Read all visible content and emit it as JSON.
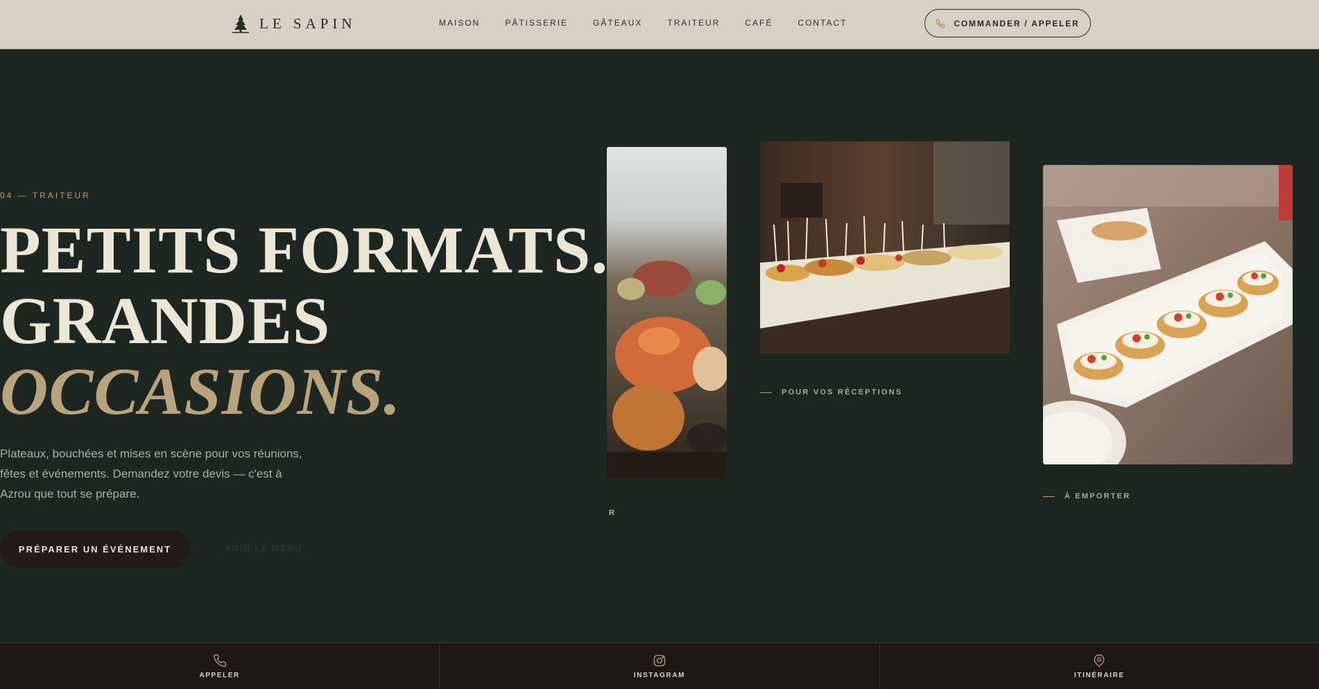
{
  "header": {
    "logo_text": "LE SAPIN",
    "nav": [
      "MAISON",
      "PÂTISSERIE",
      "GÂTEAUX",
      "TRAITEUR",
      "CAFÉ",
      "CONTACT"
    ],
    "cta_label": "COMMANDER / APPELER"
  },
  "hero": {
    "eyebrow": "04 — TRAITEUR",
    "headline_line1": "PETITS FORMATS.",
    "headline_line2": "GRANDES",
    "headline_line3": "OCCASIONS.",
    "intro": "Plateaux, bouchées et mises en scène pour vos réunions, fêtes et événements. Demandez votre devis — c'est à Azrou que tout se prépare.",
    "primary_button": "PRÉPARER UN ÉVÉNEMENT",
    "secondary_button": "VOIR LE MENU"
  },
  "gallery": {
    "caption1": "R",
    "caption2": "POUR VOS RÉCEPTIONS",
    "caption3": "À EMPORTER"
  },
  "bottom_bar": [
    {
      "label": "APPELER",
      "icon": "phone-icon"
    },
    {
      "label": "INSTAGRAM",
      "icon": "instagram-icon"
    },
    {
      "label": "ITINÉRAIRE",
      "icon": "map-pin-icon"
    }
  ],
  "colors": {
    "header_bg": "#d6d1c3",
    "page_bg": "#1e2622",
    "accent_gold": "#b8a37c",
    "headline_cream": "#ece6d6",
    "bottom_bar_bg": "#1d1816"
  }
}
